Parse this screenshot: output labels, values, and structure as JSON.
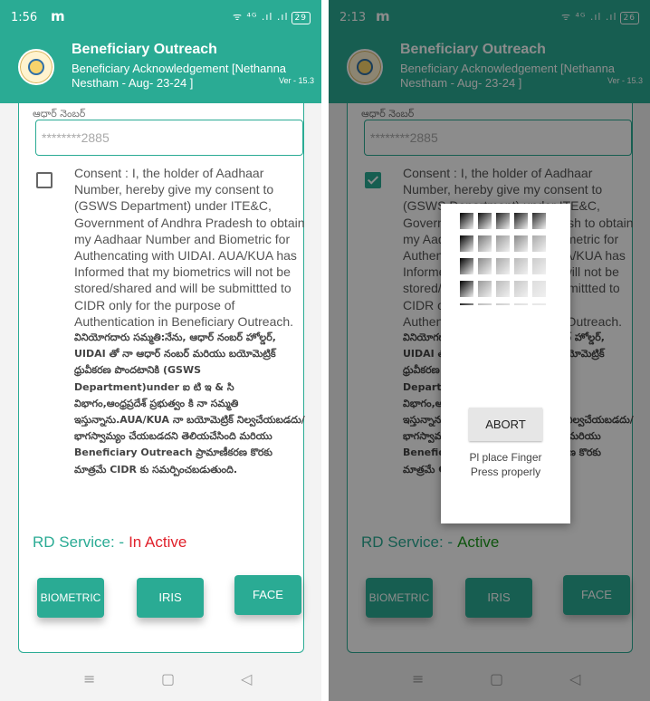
{
  "left": {
    "status": {
      "time": "1:56",
      "carrier_icon": "m",
      "signal": "ᯤ ⁴ᴳ .ıl .ıl",
      "battery": "29"
    },
    "rd_state": "In Active"
  },
  "right": {
    "status": {
      "time": "2:13",
      "carrier_icon": "m",
      "signal": "ᯤ ⁴ᴳ .ıl .ıl",
      "battery": "26"
    },
    "rd_state": "Active",
    "dialog": {
      "abort_label": "ABORT",
      "message": "Pl place Finger\nPress properly"
    }
  },
  "header": {
    "title": "Beneficiary Outreach",
    "subtitle": "Beneficiary Acknowledgement [Nethanna Nestham - Aug- 23-24 ]",
    "version": "Ver - 15.3"
  },
  "form": {
    "aadhaar_label": "ఆధార్ నెంబర్",
    "aadhaar_value": "********2885",
    "consent_en": "Consent : I, the holder of Aadhaar Number, hereby give my consent to (GSWS Department) under ITE&C, Government of Andhra Pradesh to obtain my Aadhaar Number and Biometric for Authencating with UIDAI. AUA/KUA has Informed that my biometrics will not be stored/shared and will be submittted to CIDR only for the purpose of Authentication in Beneficiary Outreach.",
    "consent_te": "వినియోగదారు సమ్మతి:నేను, ఆధార్ నంబర్ హోల్డర్, UIDAI తో నా ఆధార్ నంబర్ మరియు బయోమెట్రిక్ ధ్రువీకరణ పొందటానికి (GSWS Department)under ఐ టి ఇ & సి విభాగం,ఆంధ్రప్రదేశ్ ప్రభుత్వం కి నా సమ్మతి ఇస్తున్నాను.AUA/KUA నా బయోమెట్రిక్ నిల్వచేయబడదు/భాగస్వామ్యం చేయబడదని తెలియచేసింది మరియు Beneficiary Outreach ప్రామాణీకరణ కొరకు మాత్రమే CIDR కు సమర్పించబడుతుంది.",
    "rd_label": "RD Service: -"
  },
  "buttons": {
    "biometric": "BIOMETRIC",
    "iris": "IRIS",
    "face": "FACE"
  },
  "nav": {
    "menu_icon": "≡",
    "home_icon": "▢",
    "back_icon": "◁"
  },
  "colors": {
    "primary": "#2aab94",
    "inactive": "#e0202a",
    "active": "#1a9a1a"
  }
}
